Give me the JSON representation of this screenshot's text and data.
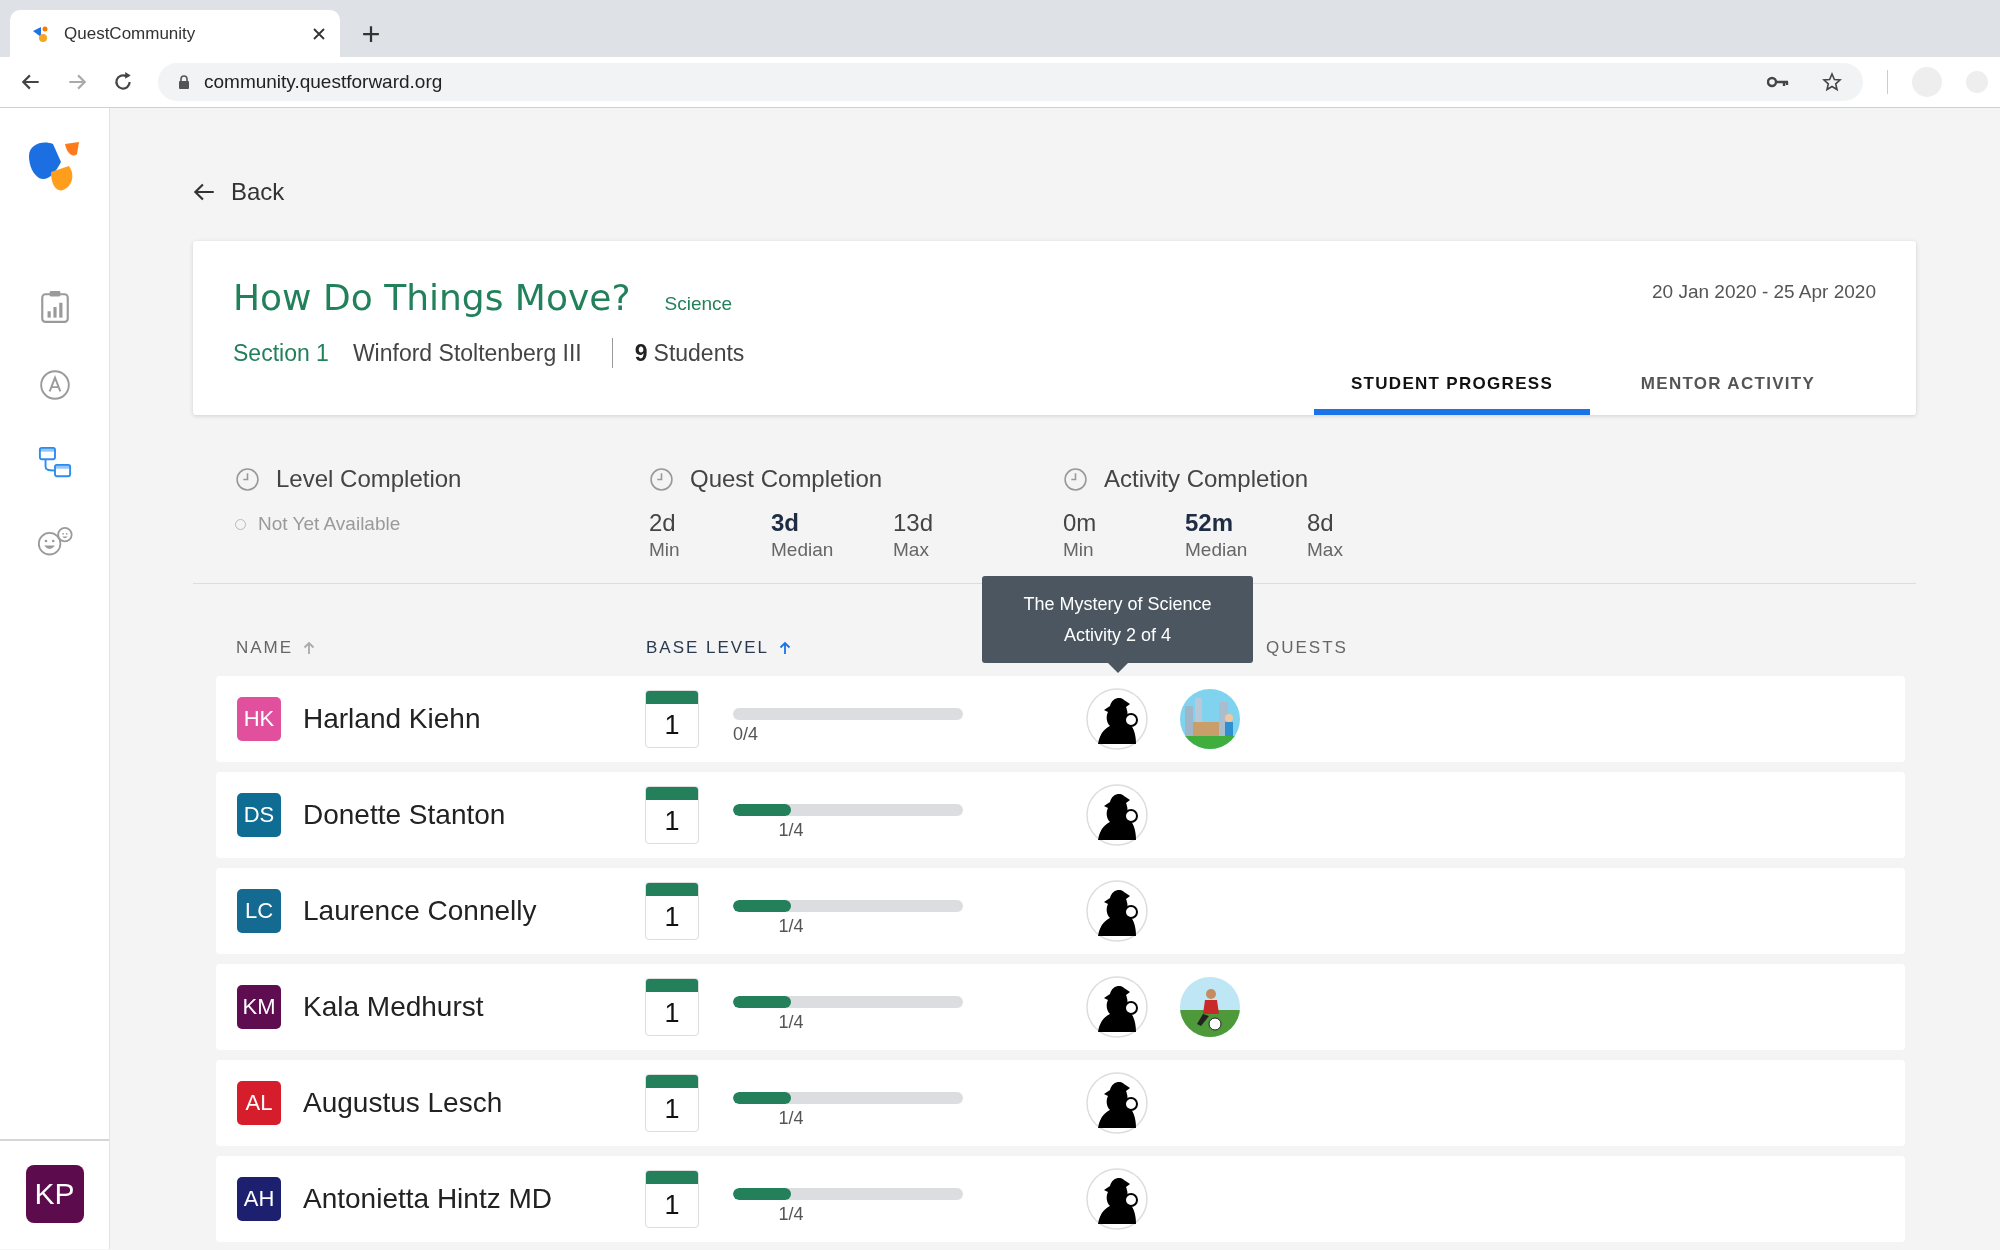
{
  "browser": {
    "tab_title": "QuestCommunity",
    "url": "community.questforward.org"
  },
  "sidebar": {
    "items": [
      {
        "kind": "report",
        "selected": false
      },
      {
        "kind": "letter",
        "selected": false
      },
      {
        "kind": "flow",
        "selected": true
      },
      {
        "kind": "faces",
        "selected": false
      }
    ],
    "user": {
      "initials": "KP",
      "color": "#5c0b4c"
    }
  },
  "back": "Back",
  "course": {
    "title": "How Do Things Move?",
    "subject": "Science",
    "section": "Section 1",
    "mentor": "Winford Stoltenberg III",
    "student_count": "9",
    "students_label": "Students",
    "dates": "20 Jan 2020 - 25 Apr 2020"
  },
  "tabs": [
    {
      "label": "STUDENT PROGRESS",
      "selected": true
    },
    {
      "label": "MENTOR ACTIVITY",
      "selected": false
    }
  ],
  "stats": [
    {
      "title": "Level Completion",
      "status": "Not Yet Available"
    },
    {
      "title": "Quest Completion",
      "values": [
        {
          "value": "2d",
          "label": "Min",
          "emphasized": false
        },
        {
          "value": "3d",
          "label": "Median",
          "emphasized": true
        },
        {
          "value": "13d",
          "label": "Max",
          "emphasized": false
        }
      ]
    },
    {
      "title": "Activity Completion",
      "values": [
        {
          "value": "0m",
          "label": "Min",
          "emphasized": false
        },
        {
          "value": "52m",
          "label": "Median",
          "emphasized": true
        },
        {
          "value": "8d",
          "label": "Max",
          "emphasized": false
        }
      ]
    }
  ],
  "table": {
    "columns": [
      {
        "label": "NAME",
        "sort_active": false
      },
      {
        "label": "BASE LEVEL",
        "sort_active": true
      },
      {
        "label": "QUESTS"
      }
    ],
    "tooltip": {
      "title": "The Mystery of Science",
      "subtitle": "Activity 2 of 4"
    },
    "rows": [
      {
        "initials": "HK",
        "color": "#e0509c",
        "name": "Harland Kiehn",
        "level_number": "1",
        "level": 0,
        "progress": "0/4",
        "quests": [
          {
            "kind": "icon"
          },
          {
            "kind": "picture"
          }
        ]
      },
      {
        "initials": "DS",
        "color": "#0f6d94",
        "name": "Donette Stanton",
        "level_number": "1",
        "level": 0.25,
        "progress": "1/4",
        "quests": [
          {
            "kind": "icon"
          }
        ]
      },
      {
        "initials": "LC",
        "color": "#146a90",
        "name": "Laurence Connelly",
        "level_number": "1",
        "level": 0.25,
        "progress": "1/4",
        "quests": [
          {
            "kind": "icon"
          }
        ]
      },
      {
        "initials": "KM",
        "color": "#5e0d50",
        "name": "Kala Medhurst",
        "level_number": "1",
        "level": 0.25,
        "progress": "1/4",
        "quests": [
          {
            "kind": "icon"
          },
          {
            "kind": "picture"
          }
        ]
      },
      {
        "initials": "AL",
        "color": "#d61d2b",
        "name": "Augustus Lesch",
        "level_number": "1",
        "level": 0.25,
        "progress": "1/4",
        "quests": [
          {
            "kind": "icon"
          }
        ]
      },
      {
        "initials": "AH",
        "color": "#1d1f6f",
        "name": "Antonietta Hintz MD",
        "level_number": "1",
        "level": 0.25,
        "progress": "1/4",
        "quests": [
          {
            "kind": "icon"
          }
        ]
      }
    ]
  }
}
